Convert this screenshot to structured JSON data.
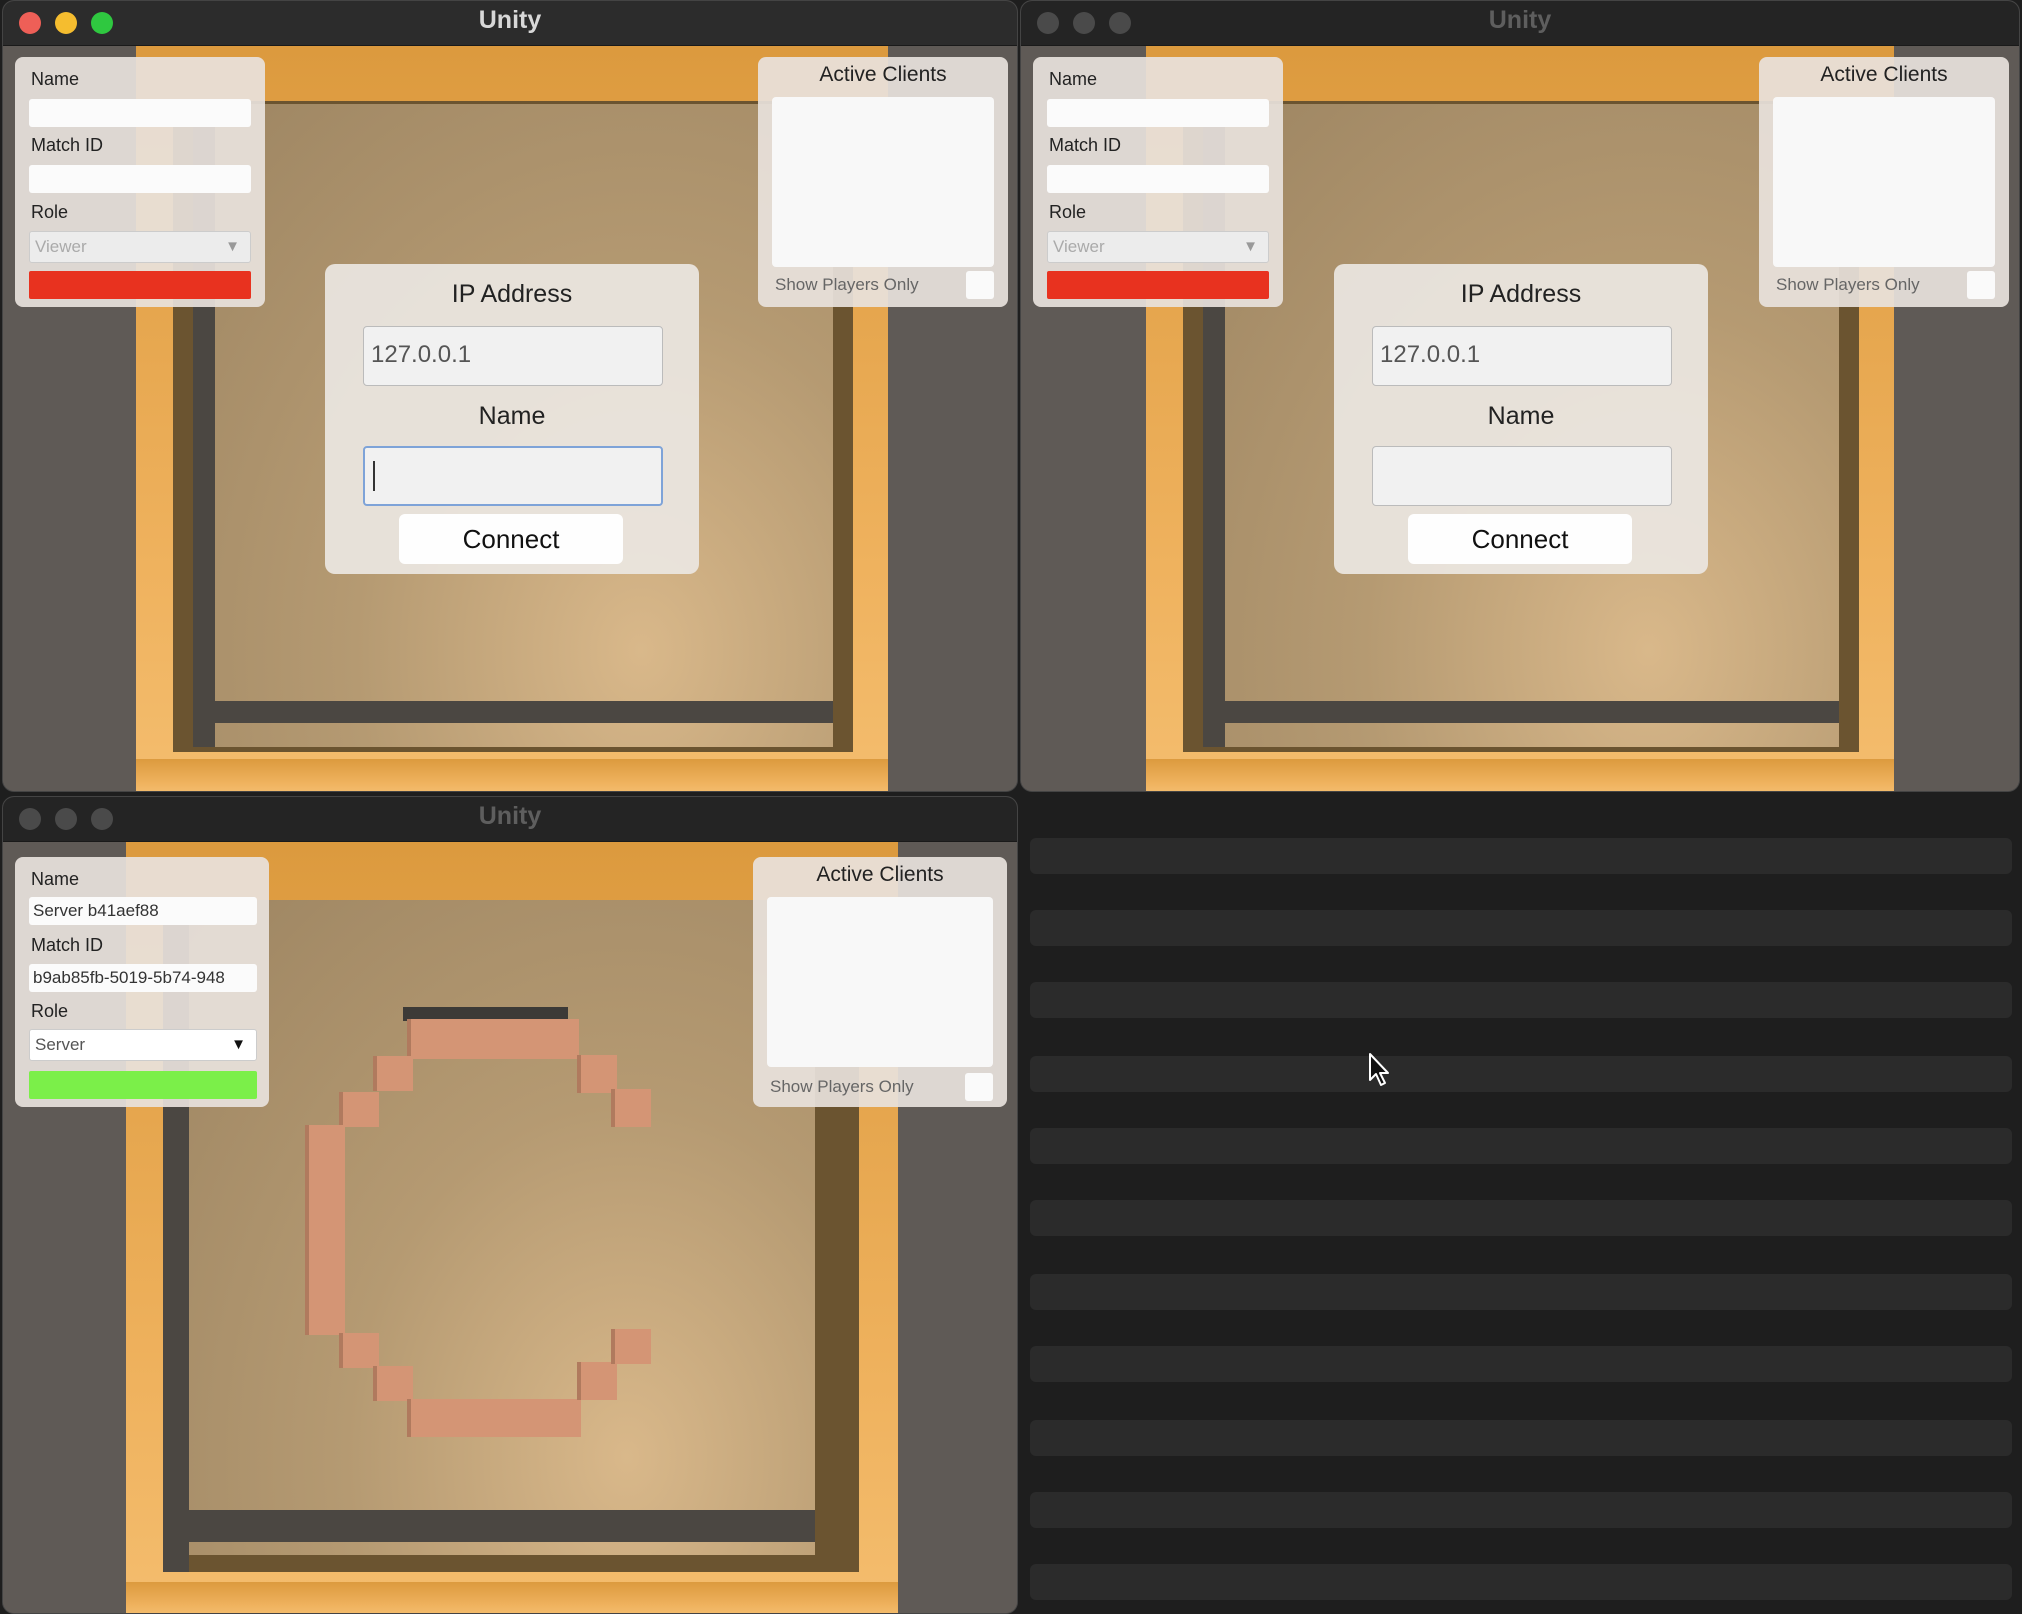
{
  "windows": [
    {
      "title": "Unity",
      "active": true,
      "left_panel": {
        "name_label": "Name",
        "name_value": "",
        "match_label": "Match ID",
        "match_value": "",
        "role_label": "Role",
        "role_value": "Viewer",
        "status_color": "#e8321f"
      },
      "clients": {
        "title": "Active Clients",
        "show_label": "Show Players Only"
      },
      "dialog": {
        "ip_label": "IP Address",
        "ip_value": "127.0.0.1",
        "name_label": "Name",
        "name_value": "",
        "connect_label": "Connect"
      }
    },
    {
      "title": "Unity",
      "active": false,
      "left_panel": {
        "name_label": "Name",
        "name_value": "",
        "match_label": "Match ID",
        "match_value": "",
        "role_label": "Role",
        "role_value": "Viewer",
        "status_color": "#e8321f"
      },
      "clients": {
        "title": "Active Clients",
        "show_label": "Show Players Only"
      },
      "dialog": {
        "ip_label": "IP Address",
        "ip_value": "127.0.0.1",
        "name_label": "Name",
        "name_value": "",
        "connect_label": "Connect"
      }
    },
    {
      "title": "Unity",
      "active": false,
      "left_panel": {
        "name_label": "Name",
        "name_value": "Server b41aef88",
        "match_label": "Match ID",
        "match_value": "b9ab85fb-5019-5b74-948",
        "role_label": "Role",
        "role_value": "Server",
        "status_color": "#7bef49"
      },
      "clients": {
        "title": "Active Clients",
        "show_label": "Show Players Only"
      }
    }
  ],
  "colors": {
    "traffic_red": "#ee5f57",
    "traffic_yellow": "#f5bd2f",
    "traffic_green": "#2fc840"
  }
}
